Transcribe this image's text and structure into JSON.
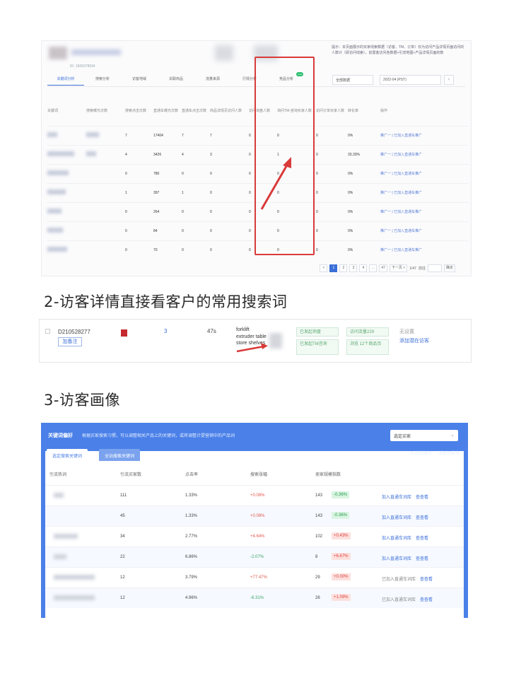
{
  "section1": {
    "id_text": "ID: 1665078934",
    "hint": "提示：本页面展示的买家线索数据（访客、TM、订单）仅为访问产品详情页面访问的人数计（即访问线索），前置客访问各数据+引流地图+产品详情页面的数",
    "tabs": [
      {
        "label": "关键词分析",
        "active": true
      },
      {
        "label": "搜索分析",
        "active": false
      },
      {
        "label": "访客地域",
        "active": false
      },
      {
        "label": "关联商品",
        "active": false
      },
      {
        "label": "流量来源",
        "active": false
      },
      {
        "label": "行情分析",
        "active": false
      },
      {
        "label": "竞品分析",
        "active": false,
        "badge": "new"
      }
    ],
    "filter_select": "全部数据",
    "date_select": "2022-04 (PST)",
    "columns": [
      "关键词",
      "搜索曝光次数",
      "搜索点击次数",
      "直通车曝光次数",
      "直通车点击次数",
      "商品详情页访问人数",
      "访问询盘人数",
      "询问TM-咨询买家人数",
      "访问订单买家人数",
      "转化率",
      "操作"
    ],
    "rows": [
      {
        "c1": "7",
        "c2": "17404",
        "c3": "7",
        "c4": "7",
        "v1": "0",
        "v2": "0",
        "v3": "0",
        "rate": "0%",
        "op": "推广一 | 已加入直通车推广"
      },
      {
        "c1": "4",
        "c2": "3426",
        "c3": "4",
        "c4": "3",
        "v1": "0",
        "v2": "1",
        "v3": "0",
        "rate": "33.33%",
        "op": "推广一 | 已加入直通车推广"
      },
      {
        "c1": "0",
        "c2": "780",
        "c3": "0",
        "c4": "0",
        "v1": "0",
        "v2": "0",
        "v3": "0",
        "rate": "0%",
        "op": "推广一 | 已加入直通车推广"
      },
      {
        "c1": "1",
        "c2": "397",
        "c3": "1",
        "c4": "0",
        "v1": "0",
        "v2": "0",
        "v3": "0",
        "rate": "0%",
        "op": "推广一 | 已加入直通车推广"
      },
      {
        "c1": "0",
        "c2": "264",
        "c3": "0",
        "c4": "0",
        "v1": "0",
        "v2": "0",
        "v3": "0",
        "rate": "0%",
        "op": "推广一 | 已加入直通车推广"
      },
      {
        "c1": "0",
        "c2": "84",
        "c3": "0",
        "c4": "0",
        "v1": "0",
        "v2": "0",
        "v3": "0",
        "rate": "0%",
        "op": "推广一 | 已加入直通车推广"
      },
      {
        "c1": "0",
        "c2": "70",
        "c3": "0",
        "c4": "0",
        "v1": "0",
        "v2": "0",
        "v3": "0",
        "rate": "0%",
        "op": "推广一 | 已加入直通车推广"
      }
    ],
    "pager": {
      "prev": "<",
      "pages": [
        "1",
        "2",
        "3",
        "4",
        "...",
        "47"
      ],
      "next": "下一页 >",
      "total": "1/47",
      "goto": "前往",
      "confirm": "确定"
    }
  },
  "caption2": "2-访客详情直接看客户的常用搜索词",
  "section2": {
    "visitor_id": "D210528277",
    "remark_btn": "加备注",
    "visit_count": "3",
    "duration": "47s",
    "keywords": [
      "forklift",
      "extruder table",
      "store shelves"
    ],
    "tags": [
      "已发起询盘",
      "已发起TM咨询",
      "访问流量229",
      "浏览 12个商品页"
    ],
    "right1": "无设置",
    "right2": "添加潜在访客"
  },
  "caption3": "3-访客画像",
  "section3": {
    "title": "关键词偏好",
    "desc": "根据买家搜索习惯，可以调整相关产品上的关键词，或将调整计提营销中的产品词",
    "select": "选定买家",
    "tabs": [
      "选定搜索关键词",
      "全站搜索关键词"
    ],
    "right_links": [
      "引流关键词",
      "关联词推荐"
    ],
    "headers": [
      "引流热词",
      "引流买家数",
      "点击率",
      "搜索涨幅",
      "卖家规模指数"
    ],
    "rows": [
      {
        "buyers": "111",
        "ctr": "1.33%",
        "growth": "+0.08%",
        "scale": "143",
        "pill": "-0.36%",
        "pill_type": "green",
        "action": "加入直通车词库",
        "view": "查查看"
      },
      {
        "buyers": "45",
        "ctr": "1.33%",
        "growth": "+0.08%",
        "scale": "143",
        "pill": "-0.36%",
        "pill_type": "green",
        "action": "加入直通车词库",
        "view": "查查看"
      },
      {
        "buyers": "34",
        "ctr": "2.77%",
        "growth": "+4.64%",
        "scale": "102",
        "pill": "+0.43%",
        "pill_type": "red",
        "action": "加入直通车词库",
        "view": "查查看"
      },
      {
        "buyers": "22",
        "ctr": "6.86%",
        "growth": "-2.07%",
        "scale": "8",
        "pill": "+6.67%",
        "pill_type": "red",
        "action": "加入直通车词库",
        "view": "查查看"
      },
      {
        "buyers": "12",
        "ctr": "3.79%",
        "growth": "+77.47%",
        "scale": "29",
        "pill": "+0.00%",
        "pill_type": "red",
        "action": "已加入直通车词库",
        "view": "查查看"
      },
      {
        "buyers": "12",
        "ctr": "4.96%",
        "growth": "-6.31%",
        "scale": "26",
        "pill": "+1.09%",
        "pill_type": "red",
        "action": "已加入直通车词库",
        "view": "查查看"
      }
    ]
  },
  "colors": {
    "accent": "#3b6fd8",
    "highlight": "#d93a3a",
    "banner": "#4a80e8"
  }
}
